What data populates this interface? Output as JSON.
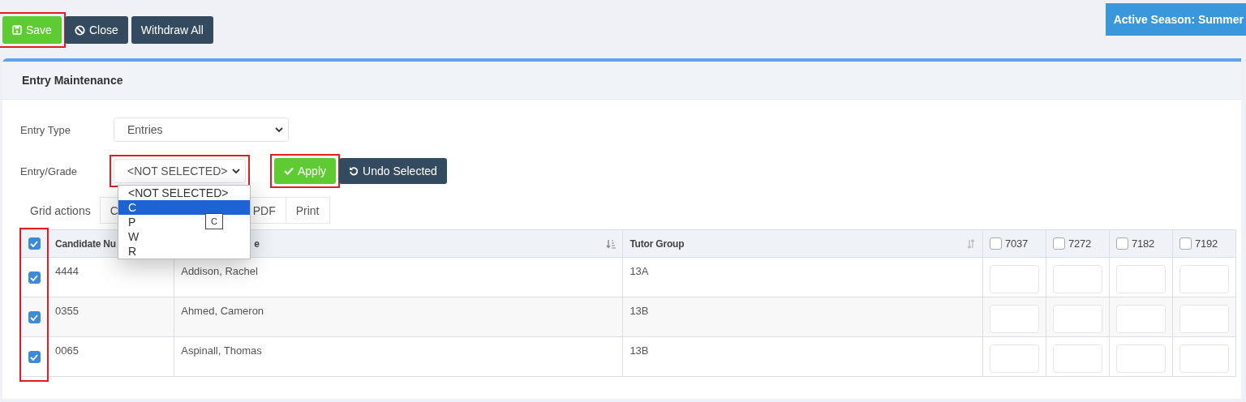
{
  "toolbar": {
    "buttons": [
      {
        "label": "Save",
        "kind": "save",
        "highlighted": true
      },
      {
        "label": "Close",
        "kind": "close",
        "highlighted": false
      },
      {
        "label": "Withdraw All",
        "kind": "plain",
        "highlighted": false
      }
    ],
    "season_badge": "Active Season: Summer"
  },
  "panel": {
    "title": "Entry Maintenance",
    "form": [
      {
        "label": "Entry Type",
        "value": "Entries",
        "highlighted": false
      },
      {
        "label": "Entry/Grade",
        "value": "<NOT SELECTED>",
        "highlighted": true
      }
    ],
    "apply_button": {
      "label": "Apply",
      "highlighted": true
    },
    "undo_button": {
      "label": "Undo Selected"
    },
    "grid_actions": {
      "label": "Grid actions",
      "buttons": [
        "C",
        "PDF",
        "Print"
      ]
    },
    "dropdown": {
      "options": [
        {
          "label": "<NOT SELECTED>",
          "selected": false
        },
        {
          "label": "C",
          "selected": true
        },
        {
          "label": "P",
          "selected": false
        },
        {
          "label": "W",
          "selected": false
        },
        {
          "label": "R",
          "selected": false
        }
      ],
      "tooltip": "C"
    },
    "table": {
      "select_all_checked": true,
      "checkbox_column_highlighted": true,
      "columns": [
        {
          "label": "Candidate Nu",
          "kind": "text"
        },
        {
          "label": "e",
          "kind": "sorted"
        },
        {
          "label": "Tutor Group",
          "kind": "sortable"
        },
        {
          "label": "7037",
          "kind": "code",
          "checked": false
        },
        {
          "label": "7272",
          "kind": "code",
          "checked": false
        },
        {
          "label": "7182",
          "kind": "code",
          "checked": false
        },
        {
          "label": "7192",
          "kind": "code",
          "checked": false
        }
      ],
      "rows": [
        {
          "selected": true,
          "cells": [
            "4444",
            "Addison, Rachel",
            "13A"
          ]
        },
        {
          "selected": true,
          "cells": [
            "0355",
            "Ahmed, Cameron",
            "13B"
          ]
        },
        {
          "selected": true,
          "cells": [
            "0065",
            "Aspinall, Thomas",
            "13B"
          ]
        }
      ]
    }
  }
}
